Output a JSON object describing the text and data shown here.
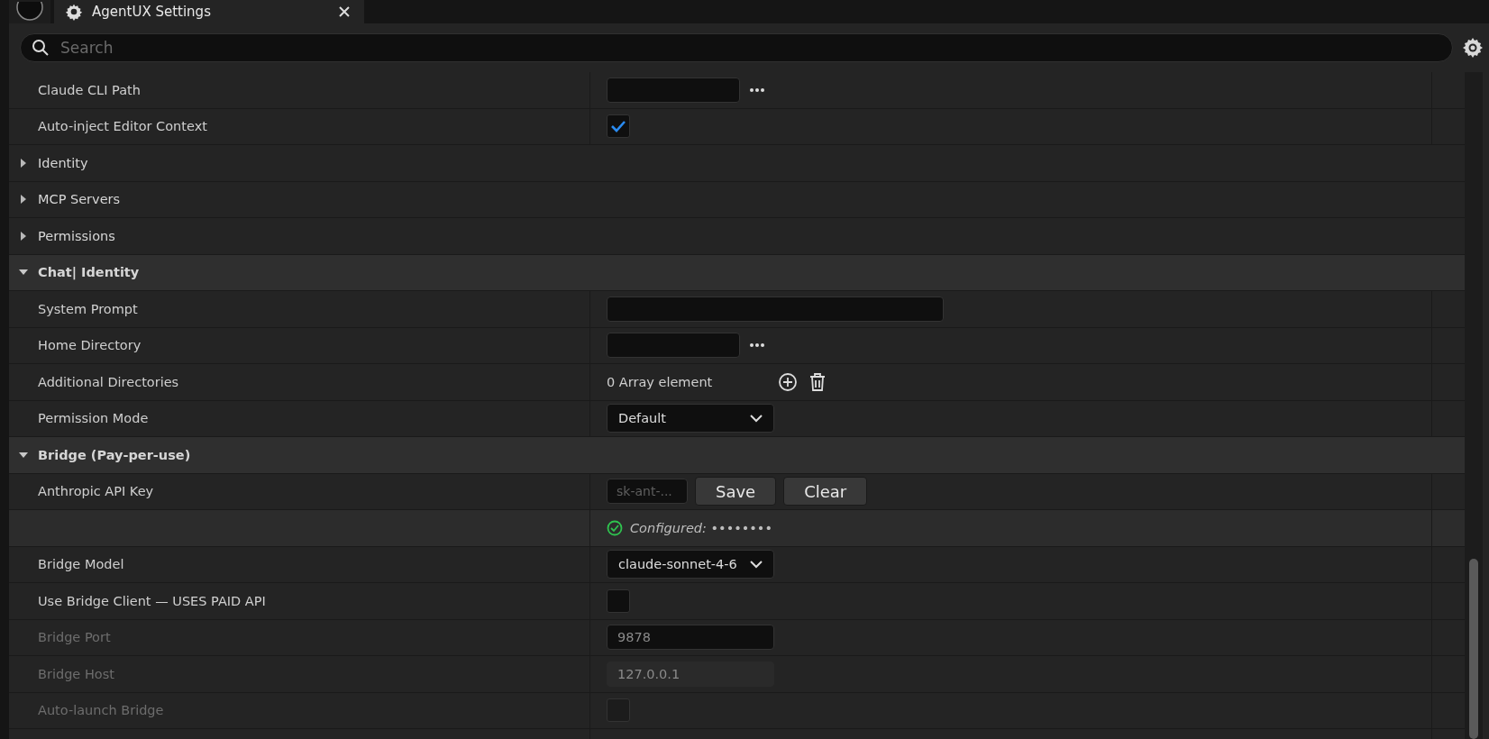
{
  "tab": {
    "title": "AgentUX Settings"
  },
  "search": {
    "placeholder": "Search"
  },
  "rows": [
    {
      "kind": "property",
      "label": "Claude CLI Path",
      "disabled": false,
      "value": {
        "kind": "path"
      }
    },
    {
      "kind": "property",
      "label": "Auto-inject Editor Context",
      "disabled": false,
      "value": {
        "kind": "checkbox",
        "checked": true
      }
    },
    {
      "kind": "category",
      "label": "Identity",
      "expanded": false
    },
    {
      "kind": "category",
      "label": "MCP Servers",
      "expanded": false
    },
    {
      "kind": "category",
      "label": "Permissions",
      "expanded": false
    },
    {
      "kind": "category",
      "label": "Chat| Identity",
      "expanded": true
    },
    {
      "kind": "property",
      "label": "System Prompt",
      "disabled": false,
      "value": {
        "kind": "long_text"
      }
    },
    {
      "kind": "property",
      "label": "Home Directory",
      "disabled": false,
      "value": {
        "kind": "path"
      }
    },
    {
      "kind": "property",
      "label": "Additional Directories",
      "disabled": false,
      "value": {
        "kind": "array",
        "text": "0 Array element"
      }
    },
    {
      "kind": "property",
      "label": "Permission Mode",
      "disabled": false,
      "value": {
        "kind": "dropdown",
        "text": "Default"
      }
    },
    {
      "kind": "category",
      "label": "Bridge (Pay-per-use)",
      "expanded": true
    },
    {
      "kind": "property",
      "label": "Anthropic API Key",
      "disabled": false,
      "value": {
        "kind": "key",
        "placeholder": "sk-ant-...",
        "buttons": [
          "Save",
          "Clear"
        ]
      }
    },
    {
      "kind": "status",
      "text": "Configured: ••••••••"
    },
    {
      "kind": "property",
      "label": "Bridge Model",
      "disabled": false,
      "value": {
        "kind": "dropdown",
        "text": "claude-sonnet-4-6"
      }
    },
    {
      "kind": "property",
      "label": "Use Bridge Client — USES PAID API",
      "disabled": false,
      "value": {
        "kind": "checkbox",
        "checked": false
      }
    },
    {
      "kind": "property",
      "label": "Bridge Port",
      "disabled": true,
      "value": {
        "kind": "text",
        "text": "9878"
      }
    },
    {
      "kind": "property",
      "label": "Bridge Host",
      "disabled": true,
      "value": {
        "kind": "readonly",
        "text": "127.0.0.1"
      }
    },
    {
      "kind": "property",
      "label": "Auto-launch Bridge",
      "disabled": true,
      "value": {
        "kind": "checkbox",
        "checked": false
      }
    }
  ]
}
